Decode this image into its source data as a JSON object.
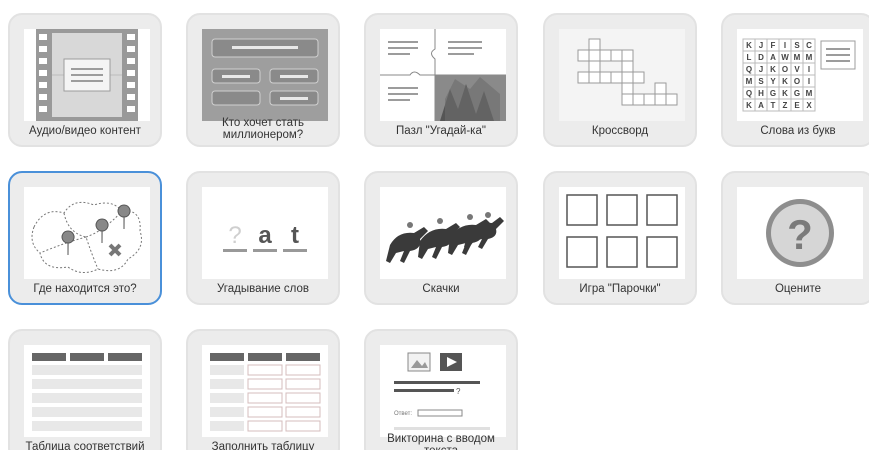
{
  "cards": [
    {
      "label": "Аудио/видео контент",
      "icon": "filmstrip-icon"
    },
    {
      "label": "Кто хочет стать миллионером?",
      "icon": "millionaire-quiz-icon"
    },
    {
      "label": "Пазл \"Угадай-ка\"",
      "icon": "puzzle-icon"
    },
    {
      "label": "Кроссворд",
      "icon": "crossword-icon"
    },
    {
      "label": "Слова из букв",
      "icon": "letter-grid-icon"
    },
    {
      "label": "Где находится это?",
      "icon": "map-pins-icon"
    },
    {
      "label": "Угадывание слов",
      "icon": "word-guess-icon"
    },
    {
      "label": "Скачки",
      "icon": "horse-race-icon"
    },
    {
      "label": "Игра \"Парочки\"",
      "icon": "pairs-grid-icon"
    },
    {
      "label": "Оцените",
      "icon": "question-mark-icon"
    },
    {
      "label": "Таблица соответствий",
      "icon": "matching-table-icon"
    },
    {
      "label": "Заполнить таблицу",
      "icon": "fill-table-icon"
    },
    {
      "label": "Викторина с вводом текста",
      "icon": "text-input-quiz-icon"
    }
  ],
  "letter_grid": [
    "KJFISC",
    "LDAWMM",
    "QJKOVI",
    "MSYKOI",
    "QHGKGM",
    "KATZEX"
  ],
  "word_guess": {
    "q": "?",
    "a": "a",
    "t": "t"
  },
  "pairs_grid_count": 6,
  "question_mark": "?",
  "text_quiz_answer_label": "Ответ:",
  "selected_index": 5,
  "colors": {
    "card_bg": "#ececec",
    "selected_border": "#4a90d9",
    "text": "#333333"
  }
}
